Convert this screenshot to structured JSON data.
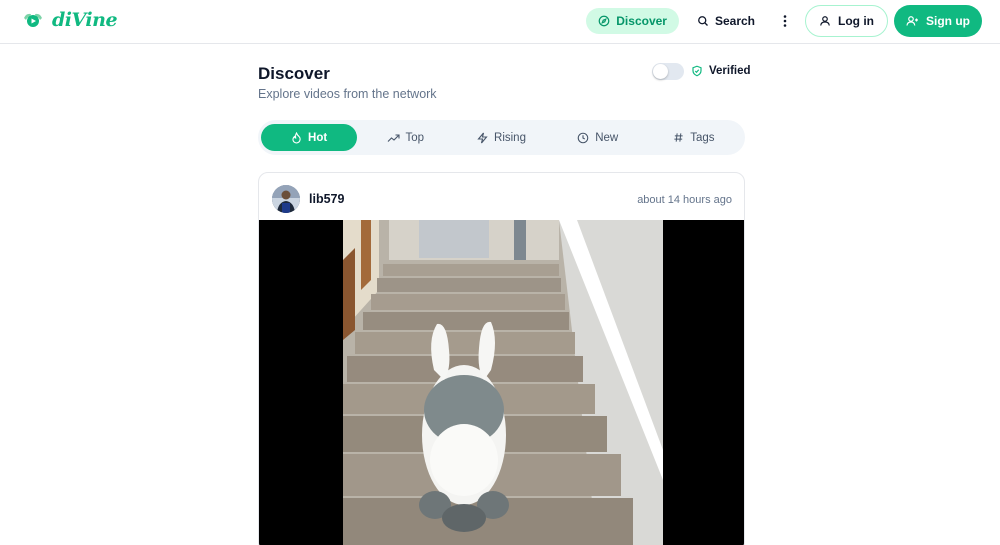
{
  "header": {
    "logo_text": "diVine",
    "nav": {
      "discover_label": "Discover",
      "search_label": "Search",
      "login_label": "Log in",
      "signup_label": "Sign up"
    }
  },
  "page": {
    "title": "Discover",
    "subtitle": "Explore videos from the network",
    "verified_label": "Verified",
    "verified_toggle_on": false
  },
  "tabs": [
    {
      "label": "Hot",
      "icon": "flame-icon",
      "active": true
    },
    {
      "label": "Top",
      "icon": "trending-up-icon",
      "active": false
    },
    {
      "label": "Rising",
      "icon": "zap-icon",
      "active": false
    },
    {
      "label": "New",
      "icon": "clock-icon",
      "active": false
    },
    {
      "label": "Tags",
      "icon": "hash-icon",
      "active": false
    }
  ],
  "feed": [
    {
      "author": "lib579",
      "timestamp": "about 14 hours ago"
    }
  ],
  "colors": {
    "accent": "#10b981",
    "accent_light": "#d1fae5"
  }
}
